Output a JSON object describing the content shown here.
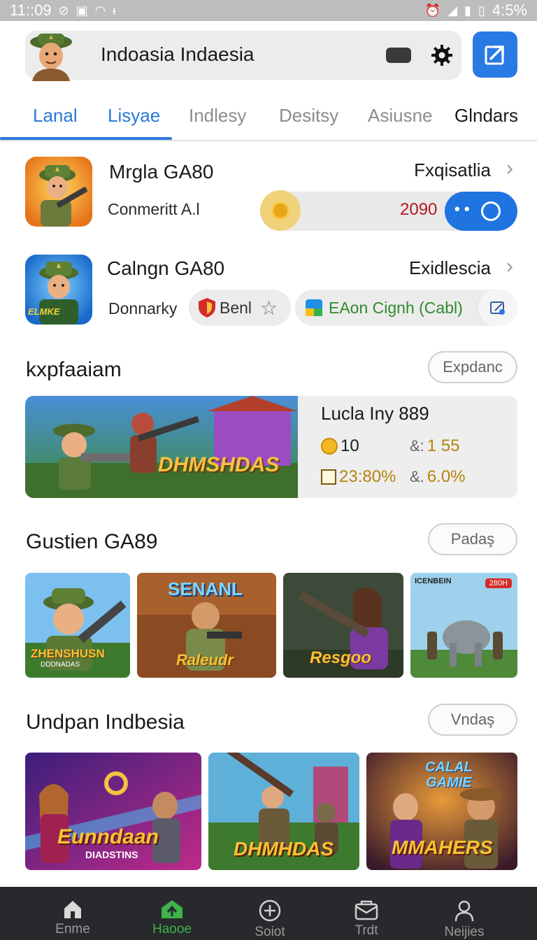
{
  "status_bar": {
    "time": "11::09",
    "battery": "4:5%"
  },
  "header": {
    "title": "Indoasia Indaesia"
  },
  "tabs": [
    "Lanal",
    "Lisyae",
    "Indlesy",
    "Desitsy",
    "Asiusne",
    "Glndars"
  ],
  "rows": [
    {
      "title": "Mrgla GA80",
      "subtitle": "Conmeritt A.l",
      "link": "Fxqisatlia",
      "value": "2090"
    },
    {
      "title": "Calngn GA80",
      "subtitle": "Donnarky",
      "link": "Exidlescia",
      "chips": {
        "first": "Benl",
        "second": "EAon Cignh (Cabl)"
      },
      "icon_text": "ELMKE"
    }
  ],
  "featured": {
    "title": "kxpfaaiam",
    "button": "Expdanc",
    "banner_text": "DHMSHDAS",
    "name": "Lucla Iny 889",
    "stats": {
      "coins": "10",
      "ratio_a": "1 55",
      "percent_a": "23:80%",
      "percent_b": "6.0%"
    }
  },
  "section2": {
    "title": "Gustien GA89",
    "button": "Padaş",
    "tiles": [
      {
        "caption": "ZHENSHUSN",
        "sub": "DDDNADAS"
      },
      {
        "caption": "SENANL",
        "sub": "Raleudr"
      },
      {
        "caption": "Resgoo",
        "sub": ""
      },
      {
        "caption": "ICENBEIN",
        "badge": "280H"
      }
    ]
  },
  "section3": {
    "title": "Undpan Indbesia",
    "button": "Vndaş",
    "tiles": [
      {
        "caption": "Eunndaan",
        "sub": "DIADSTINS"
      },
      {
        "caption": "DHMHDAS",
        "sub": ""
      },
      {
        "caption": "MMAHERS",
        "top": "CALAL GAMIE"
      }
    ]
  },
  "bottom_nav": [
    "Enme",
    "Haooe",
    "Soiot",
    "Trdt",
    "Neijies"
  ],
  "colors": {
    "accent": "#2b79d8",
    "nav_active": "#3fb24a",
    "value_red": "#b5161d"
  }
}
